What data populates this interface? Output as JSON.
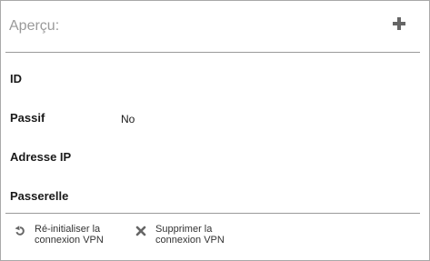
{
  "panel": {
    "title": "Aperçu:",
    "add_icon": "plus-icon"
  },
  "fields": [
    {
      "label": "ID",
      "value": ""
    },
    {
      "label": "Passif",
      "value": "No"
    },
    {
      "label": "Adresse IP",
      "value": ""
    },
    {
      "label": "Passerelle",
      "value": ""
    }
  ],
  "actions": {
    "reset": {
      "icon": "rotate-icon",
      "line1": "Ré-initialiser la",
      "line2": "connexion VPN"
    },
    "delete": {
      "icon": "x-icon",
      "line1": "Supprimer la",
      "line2": "connexion VPN"
    }
  },
  "colors": {
    "icon": "#666666",
    "title": "#9a9a9a",
    "border": "#a9a9a9"
  }
}
